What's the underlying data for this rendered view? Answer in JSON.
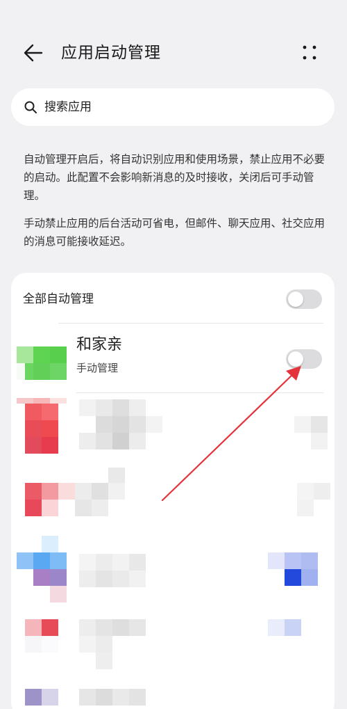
{
  "header": {
    "title": "应用启动管理",
    "back_icon": "arrow-left-icon",
    "more_icon": "more-dots-icon"
  },
  "search": {
    "placeholder": "搜索应用"
  },
  "description": {
    "paragraph1": "自动管理开启后，将自动识别应用和使用场景，禁止应用不必要的启动。此配置不会影响新消息的及时接收，关闭后可手动管理。",
    "paragraph2": "手动禁止应用的后台活动可省电，但邮件、聊天应用、社交应用的消息可能接收延迟。"
  },
  "list": {
    "all_auto_manage_label": "全部自动管理",
    "all_auto_manage_on": false,
    "apps": [
      {
        "name": "和家亲",
        "status": "手动管理",
        "toggle_on": false,
        "icon_color": "#5cce52"
      }
    ]
  },
  "colors": {
    "background": "#f1f1f3",
    "card": "#ffffff",
    "toggle_off": "#dcdcde",
    "annotation_arrow": "#e5333b"
  }
}
